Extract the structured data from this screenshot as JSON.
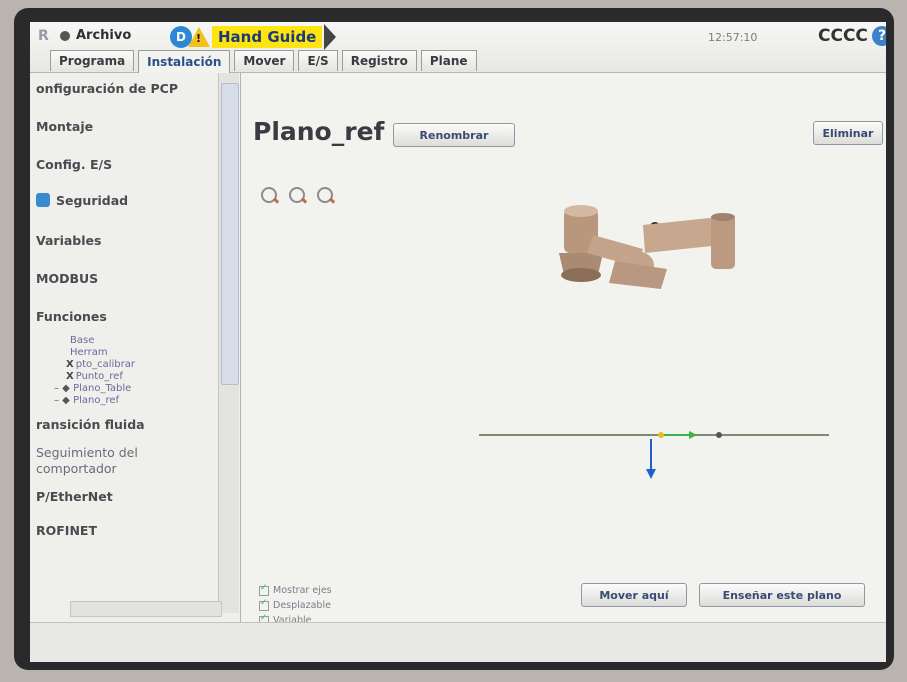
{
  "topbar": {
    "file_menu": "Archivo",
    "hand_guide_badge": "D",
    "hand_guide_warning": "!",
    "hand_guide_label": "Hand Guide",
    "clock": "12:57:10",
    "robot_name": "CCCC",
    "help_label": "?"
  },
  "tabs": [
    {
      "label": "Programa",
      "active": false
    },
    {
      "label": "Instalación",
      "active": true
    },
    {
      "label": "Mover",
      "active": false
    },
    {
      "label": "E/S",
      "active": false
    },
    {
      "label": "Registro",
      "active": false
    },
    {
      "label": "Plane",
      "active": false
    }
  ],
  "sidebar": {
    "items": [
      {
        "label": "onfiguración de PCP"
      },
      {
        "label": "Montaje"
      },
      {
        "label": "Config. E/S"
      },
      {
        "label": "Seguridad",
        "icon": "shield-icon"
      },
      {
        "label": "Variables"
      },
      {
        "label": "MODBUS"
      },
      {
        "label": "Funciones"
      },
      {
        "label": "ransición fluida"
      },
      {
        "label": "Seguimiento del"
      },
      {
        "label": "comportador"
      },
      {
        "label": "P/EtherNet"
      },
      {
        "label": "ROFINET"
      }
    ],
    "sub_items": [
      {
        "label": "Base"
      },
      {
        "label": "Herram"
      },
      {
        "label": "pto_calibrar",
        "mark": "X"
      },
      {
        "label": "Punto_ref",
        "mark": "X"
      },
      {
        "label": "Plano_Table"
      },
      {
        "label": "Plano_ref"
      }
    ]
  },
  "main": {
    "title": "Plano_ref",
    "rename_button": "Renombrar",
    "delete_button": "Eliminar",
    "move_here_button": "Mover aquí",
    "teach_button": "Enseñar este plano",
    "checkboxes": [
      {
        "label": "Mostrar ejes",
        "checked": true
      },
      {
        "label": "Desplazable",
        "checked": true
      },
      {
        "label": "Variable",
        "checked": true
      }
    ],
    "zoom_icons": [
      "zoom-in-icon",
      "zoom-reset-icon",
      "zoom-out-icon"
    ]
  },
  "colors": {
    "active_tab": "#2c4f8a",
    "hand_guide_bg": "#ffe40d",
    "axis_blue": "#1f5fd0",
    "axis_green": "#3cb34a",
    "axis_yellow": "#e0c020",
    "robot_tan": "#c9a88c"
  }
}
